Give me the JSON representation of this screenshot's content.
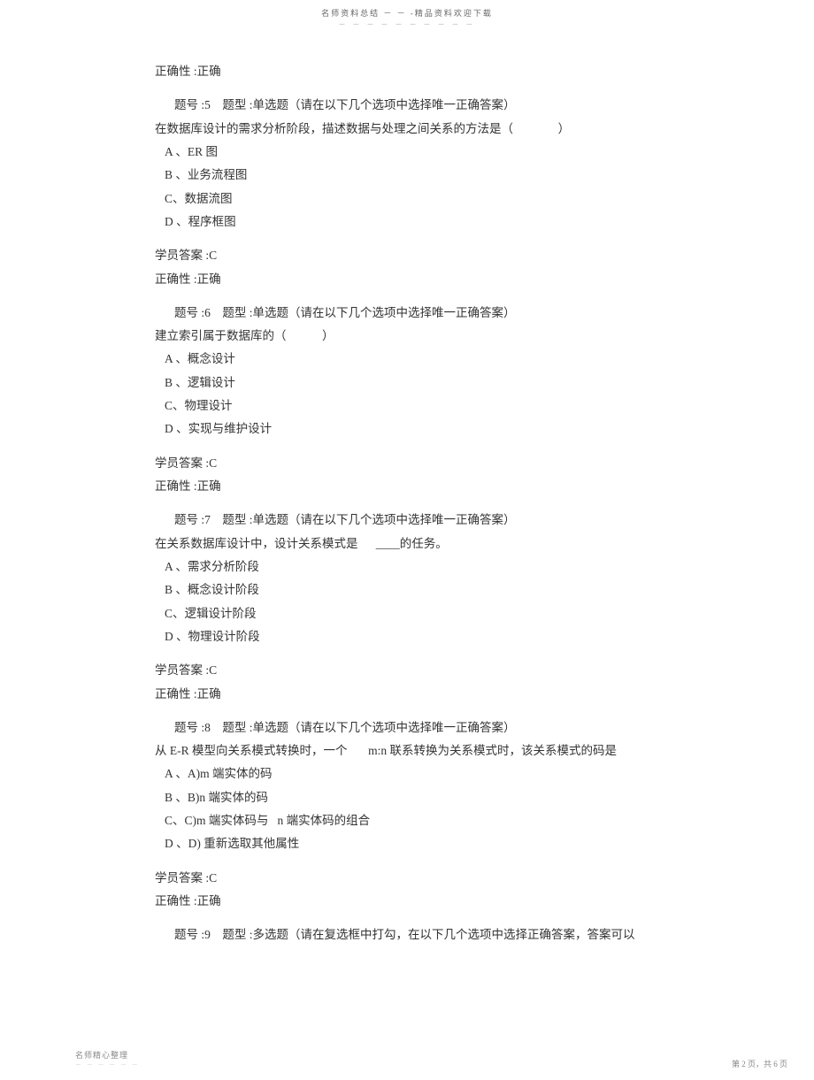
{
  "header": {
    "text": "名师资料总结  － － -精品资料欢迎下载",
    "dashes": "－ － － － － － － － － －"
  },
  "prev_correctness": "正确性 :正确",
  "questions": [
    {
      "header": "题号 :5    题型 :单选题（请在以下几个选项中选择唯一正确答案）",
      "stem": "在数据库设计的需求分析阶段，描述数据与处理之间关系的方法是（               ）",
      "options": [
        "A 、ER 图",
        "B 、业务流程图",
        "C、数据流图",
        "D 、程序框图"
      ],
      "answer": "学员答案 :C",
      "correctness": "正确性 :正确"
    },
    {
      "header": "题号 :6    题型 :单选题（请在以下几个选项中选择唯一正确答案）",
      "stem": "建立索引属于数据库的（            ）",
      "options": [
        "A 、概念设计",
        "B 、逻辑设计",
        "C、物理设计",
        "D 、实现与维护设计"
      ],
      "answer": "学员答案 :C",
      "correctness": "正确性 :正确"
    },
    {
      "header": "题号 :7    题型 :单选题（请在以下几个选项中选择唯一正确答案）",
      "stem": "在关系数据库设计中，设计关系模式是      ____的任务。",
      "options": [
        "A 、需求分析阶段",
        "B 、概念设计阶段",
        "C、逻辑设计阶段",
        "D 、物理设计阶段"
      ],
      "answer": "学员答案 :C",
      "correctness": "正确性 :正确"
    },
    {
      "header": "题号 :8    题型 :单选题（请在以下几个选项中选择唯一正确答案）",
      "stem_blank": "",
      "stem": "从 E-R 模型向关系模式转换时，一个       m:n 联系转换为关系模式时，该关系模式的码是",
      "options": [
        "A 、A)m 端实体的码",
        "B 、B)n 端实体的码",
        "C、C)m 端实体码与   n 端实体码的组合",
        "D 、D) 重新选取其他属性"
      ],
      "answer": "学员答案 :C",
      "correctness": "正确性 :正确"
    },
    {
      "header": "题号 :9    题型 :多选题（请在复选框中打勾，在以下几个选项中选择正确答案，答案可以"
    }
  ],
  "footer": {
    "left": "名师精心整理",
    "left_dashes": "－ － － － － －",
    "right": "第 2 页，共 6 页"
  }
}
